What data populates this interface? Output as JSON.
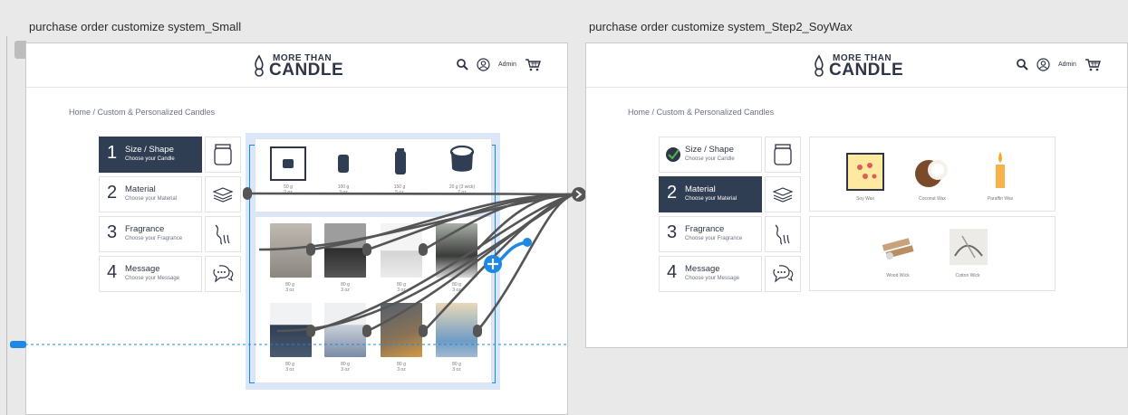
{
  "frames": {
    "left_title": "purchase order customize system_Small",
    "right_title": "purchase order customize system_Step2_SoyWax"
  },
  "logo": {
    "top": "MORE THAN",
    "main": "CANDLE"
  },
  "header": {
    "admin_label": "Admin"
  },
  "breadcrumb": "Home / Custom & Personalized Candles",
  "steps": [
    {
      "num": "1",
      "title": "Size / Shape",
      "desc": "Choose your Candle"
    },
    {
      "num": "2",
      "title": "Material",
      "desc": "Choose your Material"
    },
    {
      "num": "3",
      "title": "Fragrance",
      "desc": "Choose your Fragrance"
    },
    {
      "num": "4",
      "title": "Message",
      "desc": "Choose your Message"
    }
  ],
  "sizes": [
    {
      "weight": "50 g",
      "oz": "2 oz"
    },
    {
      "weight": "100 g",
      "oz": "3 oz"
    },
    {
      "weight": "150 g",
      "oz": "5 oz"
    },
    {
      "weight": "20 g (3 wick)",
      "oz": "7 oz"
    }
  ],
  "product_captions": {
    "weight": "80 g",
    "oz": "3 oz"
  },
  "materials_top": [
    "Soy Wax",
    "Coconut Wax",
    "Paraffin Wax"
  ],
  "materials_bottom": [
    "Wood Wick",
    "Cotton Wick"
  ],
  "colors": {
    "navy": "#2f3e52",
    "selection_blue": "#1e88e5",
    "connector_gray": "#555555"
  }
}
